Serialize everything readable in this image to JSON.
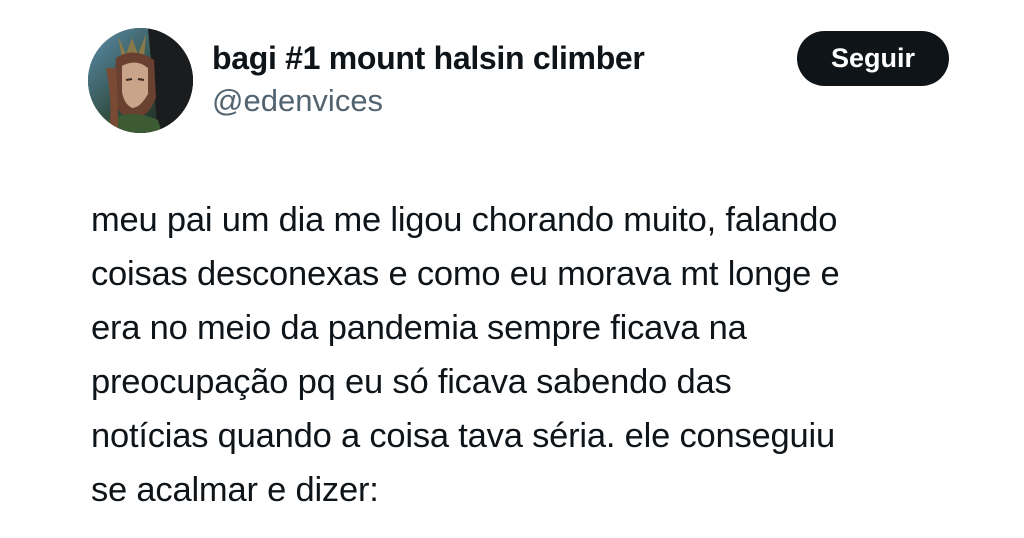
{
  "author": {
    "display_name": "bagi #1 mount halsin climber",
    "handle": "@edenvices",
    "avatar_icon": "profile-avatar"
  },
  "actions": {
    "follow_label": "Seguir"
  },
  "tweet": {
    "lines": [
      "meu pai um dia me ligou chorando muito, falando",
      "coisas desconexas e como eu morava mt longe e",
      "era no meio da pandemia sempre ficava na",
      "preocupação pq eu só ficava sabendo das",
      "notícias quando a coisa tava séria. ele conseguiu",
      "se acalmar e dizer:"
    ]
  },
  "colors": {
    "text_primary": "#0f1419",
    "text_secondary": "#536471",
    "button_bg": "#0f1419",
    "button_text": "#ffffff",
    "background": "#ffffff"
  }
}
